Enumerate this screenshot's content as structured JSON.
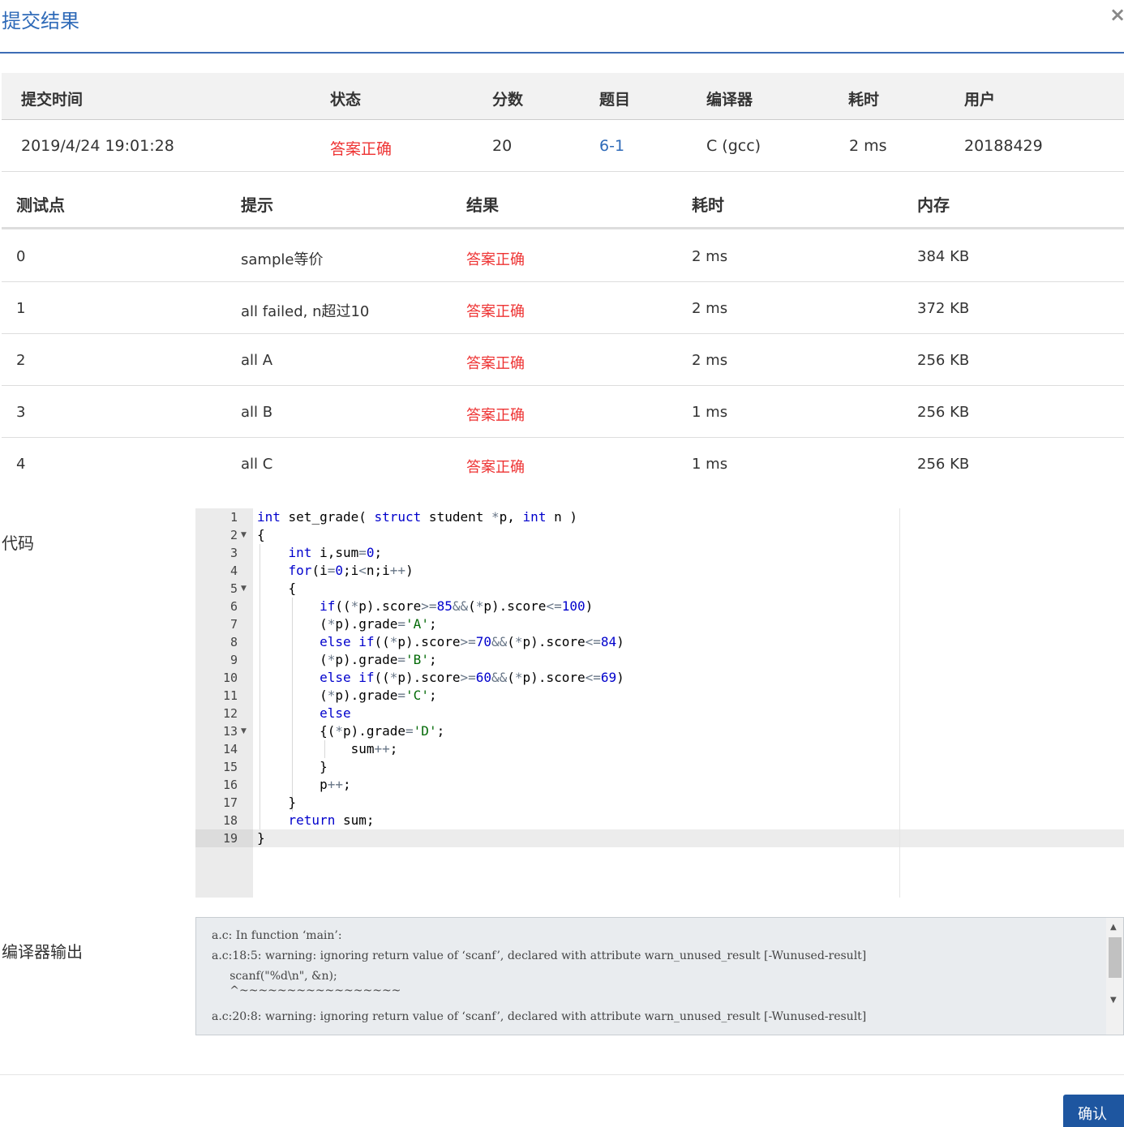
{
  "modal": {
    "title": "提交结果",
    "close_label": "×"
  },
  "submission": {
    "headers": [
      "提交时间",
      "状态",
      "分数",
      "题目",
      "编译器",
      "耗时",
      "用户"
    ],
    "row": {
      "time": "2019/4/24 19:01:28",
      "status": "答案正确",
      "score": "20",
      "problem": "6-1",
      "compiler": "C (gcc)",
      "elapsed": "2 ms",
      "user": "20188429"
    }
  },
  "testcases": {
    "headers": [
      "测试点",
      "提示",
      "结果",
      "耗时",
      "内存"
    ],
    "rows": [
      {
        "id": "0",
        "hint": "sample等价",
        "result": "答案正确",
        "time": "2 ms",
        "memory": "384 KB"
      },
      {
        "id": "1",
        "hint": "all failed, n超过10",
        "result": "答案正确",
        "time": "2 ms",
        "memory": "372 KB"
      },
      {
        "id": "2",
        "hint": "all A",
        "result": "答案正确",
        "time": "2 ms",
        "memory": "256 KB"
      },
      {
        "id": "3",
        "hint": "all B",
        "result": "答案正确",
        "time": "1 ms",
        "memory": "256 KB"
      },
      {
        "id": "4",
        "hint": "all C",
        "result": "答案正确",
        "time": "1 ms",
        "memory": "256 KB"
      }
    ]
  },
  "code_label": "代码",
  "code_lines": [
    "int set_grade( struct student *p, int n )",
    "{",
    "    int i,sum=0;",
    "    for(i=0;i<n;i++)",
    "    {",
    "        if((*p).score>=85&&(*p).score<=100)",
    "        (*p).grade='A';",
    "        else if((*p).score>=70&&(*p).score<=84)",
    "        (*p).grade='B';",
    "        else if((*p).score>=60&&(*p).score<=69)",
    "        (*p).grade='C';",
    "        else",
    "        {(*p).grade='D';",
    "            sum++;",
    "        }",
    "        p++;",
    "    }",
    "    return sum;",
    "}"
  ],
  "fold_lines": [
    2,
    5,
    13
  ],
  "output_label": "编译器输出",
  "compiler_output": [
    "a.c: In function ‘main’:",
    "a.c:18:5: warning: ignoring return value of ‘scanf’, declared with attribute warn_unused_result [-Wunused-result]",
    "     scanf(\"%d\\n\", &n);",
    "     ^~~~~~~~~~~~~~~~~~",
    "a.c:20:8: warning: ignoring return value of ‘scanf’, declared with attribute warn_unused_result [-Wunused-result]"
  ],
  "confirm_label": "确认"
}
